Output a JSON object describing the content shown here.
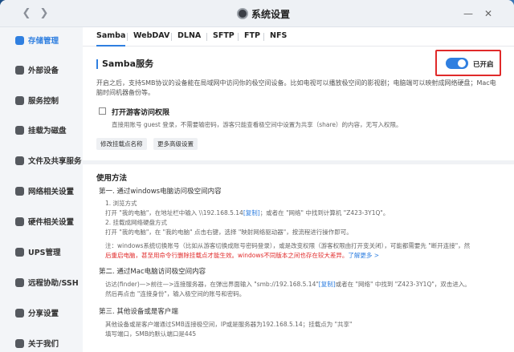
{
  "window": {
    "title": "系统设置"
  },
  "sidebar": {
    "items": [
      {
        "label": "存储管理",
        "active": true
      },
      {
        "label": "外部设备"
      },
      {
        "label": "服务控制"
      },
      {
        "label": "挂载为磁盘"
      },
      {
        "label": "文件及共享服务"
      },
      {
        "label": "网络相关设置"
      },
      {
        "label": "硬件相关设置"
      },
      {
        "label": "UPS管理"
      },
      {
        "label": "远程协助/SSH"
      },
      {
        "label": "分享设置"
      },
      {
        "label": "关于我们"
      }
    ]
  },
  "tabs": [
    "Samba",
    "WebDAV",
    "DLNA",
    "SFTP",
    "FTP",
    "NFS"
  ],
  "samba": {
    "title": "Samba服务",
    "toggle_label": "已开启",
    "enabled": true,
    "description": "开启之后，支持SMB协议的设备能在局域网中访问你的极空间设备。比如电视可以播放极空间的影视剧；电脑端可以映射成网络硬盘；Mac电脑时间机器备份等。",
    "guest_label": "打开游客访问权限",
    "guest_hint": "直接用账号 guest 登录，不需要输密码，游客只能查看极空间中设置为共享（share）的内容，无写入权限。",
    "btn_edit": "修改挂载点名称",
    "btn_more": "更多高级设置"
  },
  "usage": {
    "title": "使用方法",
    "step1_title": "第一. 通过windows电脑访问极空间内容",
    "step1_a": "1. 浏览方式",
    "step1_a_text": "打开 \"我的电脑\"，在地址栏中输入 \\\\192.168.5.14",
    "copy": "[复制]",
    "step1_a_text2": "；或者在 \"网络\" 中找到计算机 \"Z423-3Y1Q\"。",
    "step1_b": "2. 挂载成网络硬盘方式",
    "step1_b_text": "打开 \"我的电脑\"，在 \"我的电脑\" 点击右键，选择 \"映射网络驱动器\"，按流程进行操作即可。",
    "note1": "注：windows系统切换账号（比如从游客切换成账号密码登录），或是改变权限（游客权限由打开变关闭），可能都需要先 \"断开连接\"，然",
    "note2": "后重启电脑，甚至用命令行删除挂载点才能生效。windows不同版本之间也存在较大差异。",
    "learn_more": "了解更多 >",
    "step2_title": "第二. 通过Mac电脑访问极空间内容",
    "step2_text": "访达(finder)—>前往—>连接服务器，在弹出界面输入 \"smb://192.168.5.14\"",
    "step2_copy": "[复制]",
    "step2_text2": "或者在 \"网络\" 中找到 \"Z423-3Y1Q\"，双击进入。",
    "step2_text3": "然后再点击 \"连接身份\"，输入极空间的账号和密码。",
    "step3_title": "第三. 其他设备或是客户端",
    "step3_text": "其他设备或是客户端通过SMB连接极空间，IP或是服务器为192.168.5.14；挂载点为 \"共享\"",
    "step3_text2": "填写端口，SMB的默认端口是445"
  }
}
